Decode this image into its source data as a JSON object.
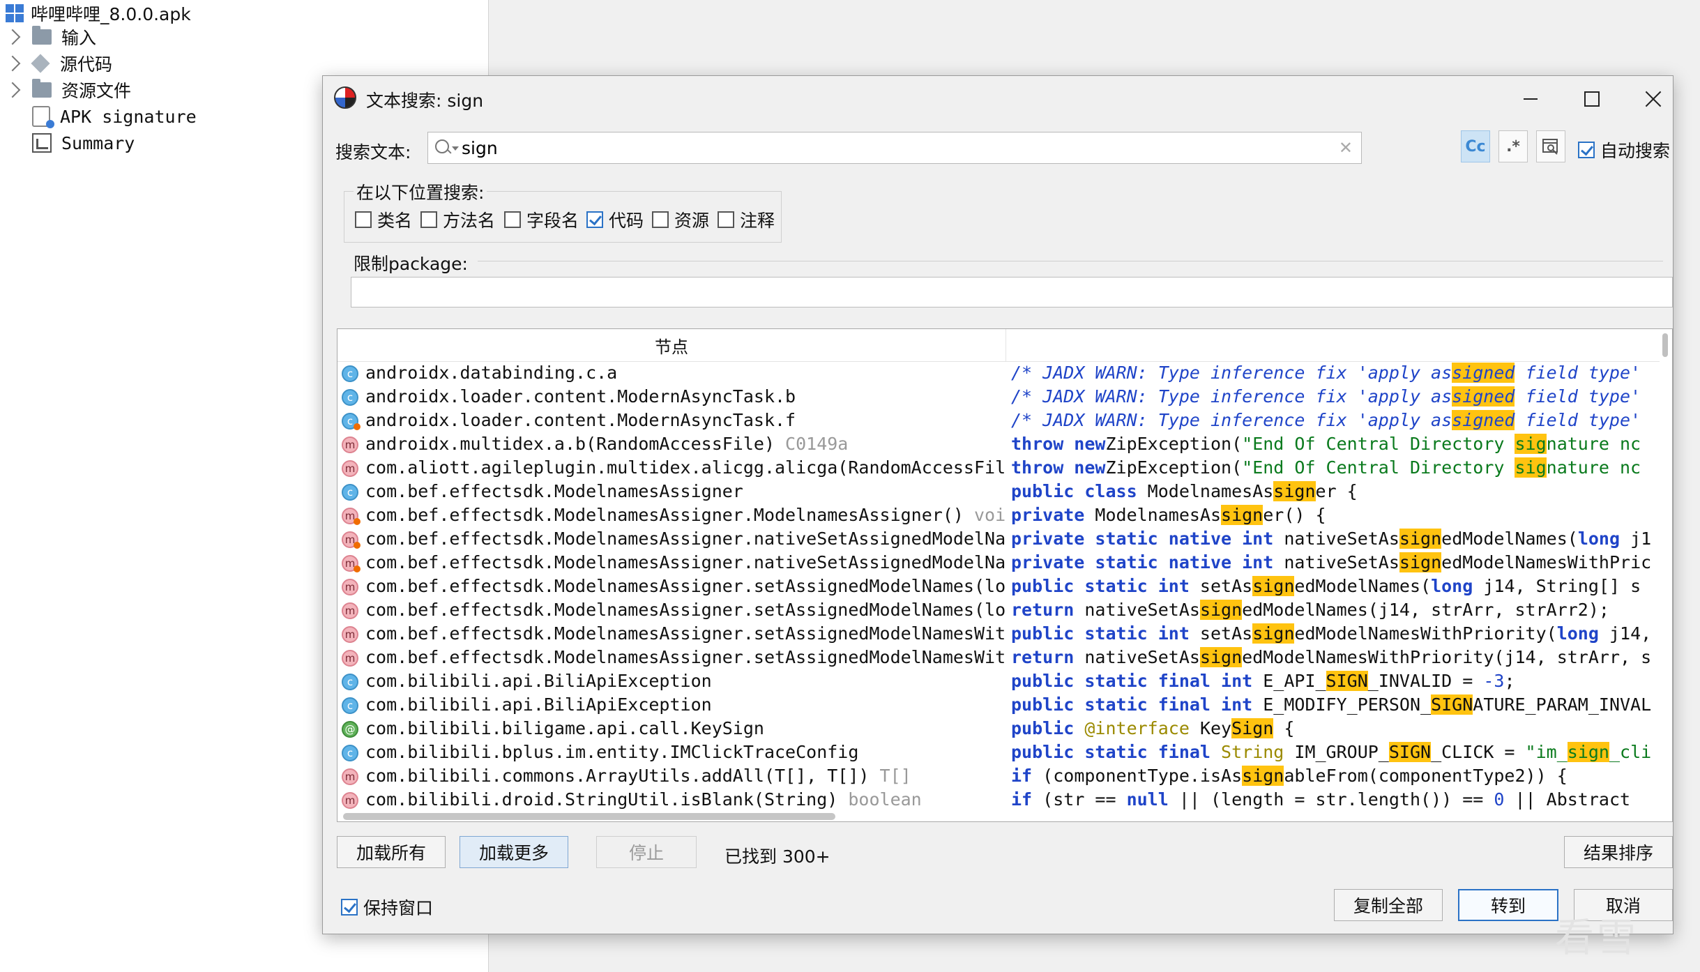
{
  "tree": {
    "root": "哔哩哔哩_8.0.0.apk",
    "items": [
      "输入",
      "源代码",
      "资源文件",
      "APK signature",
      "Summary"
    ]
  },
  "dialog": {
    "title": "文本搜索: sign",
    "search_label": "搜索文本:",
    "search_value": "sign",
    "case_label": "Cc",
    "regex_label": ".*",
    "auto_search_label": "自动搜索",
    "scope_title": "在以下位置搜索:",
    "scope_options": [
      {
        "label": "类名",
        "checked": false
      },
      {
        "label": "方法名",
        "checked": false
      },
      {
        "label": "字段名",
        "checked": false
      },
      {
        "label": "代码",
        "checked": true
      },
      {
        "label": "资源",
        "checked": false
      },
      {
        "label": "注释",
        "checked": false
      }
    ],
    "package_label": "限制package:",
    "package_value": "",
    "column_node": "节点",
    "rows": [
      {
        "icon": "class",
        "dot": "",
        "node": "androidx.databinding.c.a",
        "sub": "",
        "code": [
          [
            "cm",
            "/* JADX WARN: Type inference fix 'apply as"
          ],
          [
            "cm hl",
            "signed"
          ],
          [
            "cm",
            " field type' "
          ]
        ]
      },
      {
        "icon": "class",
        "dot": "",
        "node": "androidx.loader.content.ModernAsyncTask.b",
        "sub": "",
        "code": [
          [
            "cm",
            "/* JADX WARN: Type inference fix 'apply as"
          ],
          [
            "cm hl",
            "signed"
          ],
          [
            "cm",
            " field type' "
          ]
        ]
      },
      {
        "icon": "class",
        "dot": "orange",
        "node": "androidx.loader.content.ModernAsyncTask.f",
        "sub": "",
        "code": [
          [
            "cm",
            "/* JADX WARN: Type inference fix 'apply as"
          ],
          [
            "cm hl",
            "signed"
          ],
          [
            "cm",
            " field type' "
          ]
        ]
      },
      {
        "icon": "method",
        "dot": "",
        "node": "androidx.multidex.a.b(RandomAccessFile)",
        "sub": " C0149a",
        "code": [
          [
            "kw",
            "throw new"
          ],
          [
            "",
            "ZipException("
          ],
          [
            "st",
            "\"End Of Central Directory "
          ],
          [
            "st hl",
            "sig"
          ],
          [
            "st",
            "nature nc"
          ]
        ]
      },
      {
        "icon": "method",
        "dot": "",
        "node": "com.aliott.agileplugin.multidex.alicgg.alicga(RandomAccessFil",
        "sub": "",
        "code": [
          [
            "kw",
            "throw new"
          ],
          [
            "",
            "ZipException("
          ],
          [
            "st",
            "\"End Of Central Directory "
          ],
          [
            "st hl",
            "sig"
          ],
          [
            "st",
            "nature nc"
          ]
        ]
      },
      {
        "icon": "class",
        "dot": "",
        "node": "com.bef.effectsdk.ModelnamesAssigner",
        "sub": "",
        "code": [
          [
            "kw",
            "public class"
          ],
          [
            "",
            " ModelnamesAs"
          ],
          [
            "hl",
            "sign"
          ],
          [
            "",
            "er {"
          ]
        ]
      },
      {
        "icon": "method",
        "dot": "orange",
        "node": "com.bef.effectsdk.ModelnamesAssigner.ModelnamesAssigner()",
        "sub": " voi",
        "code": [
          [
            "kw",
            "private"
          ],
          [
            "",
            " ModelnamesAs"
          ],
          [
            "hl",
            "sign"
          ],
          [
            "",
            "er() {"
          ]
        ]
      },
      {
        "icon": "method",
        "dot": "orange",
        "node": "com.bef.effectsdk.ModelnamesAssigner.nativeSetAssignedModelNa",
        "sub": "",
        "code": [
          [
            "kw",
            "private static native int"
          ],
          [
            "",
            " nativeSetAs"
          ],
          [
            "hl",
            "sign"
          ],
          [
            "",
            "edModelNames("
          ],
          [
            "kw",
            "long"
          ],
          [
            "",
            " j1"
          ]
        ]
      },
      {
        "icon": "method",
        "dot": "orange",
        "node": "com.bef.effectsdk.ModelnamesAssigner.nativeSetAssignedModelNa",
        "sub": "",
        "code": [
          [
            "kw",
            "private static native int"
          ],
          [
            "",
            " nativeSetAs"
          ],
          [
            "hl",
            "sign"
          ],
          [
            "",
            "edModelNamesWithPric"
          ]
        ]
      },
      {
        "icon": "method",
        "dot": "",
        "node": "com.bef.effectsdk.ModelnamesAssigner.setAssignedModelNames(lo",
        "sub": "",
        "code": [
          [
            "kw",
            "public static int"
          ],
          [
            "",
            " setAs"
          ],
          [
            "hl",
            "sign"
          ],
          [
            "",
            "edModelNames("
          ],
          [
            "kw",
            "long"
          ],
          [
            "",
            " j14, String[] s"
          ]
        ]
      },
      {
        "icon": "method",
        "dot": "",
        "node": "com.bef.effectsdk.ModelnamesAssigner.setAssignedModelNames(lo",
        "sub": "",
        "code": [
          [
            "kw",
            "return"
          ],
          [
            "",
            " nativeSetAs"
          ],
          [
            "hl",
            "sign"
          ],
          [
            "",
            "edModelNames(j14, strArr, strArr2);"
          ]
        ]
      },
      {
        "icon": "method",
        "dot": "",
        "node": "com.bef.effectsdk.ModelnamesAssigner.setAssignedModelNamesWit",
        "sub": "",
        "code": [
          [
            "kw",
            "public static int"
          ],
          [
            "",
            " setAs"
          ],
          [
            "hl",
            "sign"
          ],
          [
            "",
            "edModelNamesWithPriority("
          ],
          [
            "kw",
            "long"
          ],
          [
            "",
            " j14,"
          ]
        ]
      },
      {
        "icon": "method",
        "dot": "",
        "node": "com.bef.effectsdk.ModelnamesAssigner.setAssignedModelNamesWit",
        "sub": "",
        "code": [
          [
            "kw",
            "return"
          ],
          [
            "",
            " nativeSetAs"
          ],
          [
            "hl",
            "sign"
          ],
          [
            "",
            "edModelNamesWithPriority(j14, strArr, s"
          ]
        ]
      },
      {
        "icon": "class",
        "dot": "",
        "node": "com.bilibili.api.BiliApiException",
        "sub": "",
        "code": [
          [
            "kw",
            "public static final int"
          ],
          [
            "",
            " E_API_"
          ],
          [
            "hl",
            "SIGN"
          ],
          [
            "",
            "_INVALID = "
          ],
          [
            "num",
            "-3"
          ],
          [
            "",
            ";"
          ]
        ]
      },
      {
        "icon": "class",
        "dot": "",
        "node": "com.bilibili.api.BiliApiException",
        "sub": "",
        "code": [
          [
            "kw",
            "public static final int"
          ],
          [
            "",
            " E_MODIFY_PERSON_"
          ],
          [
            "hl",
            "SIGN"
          ],
          [
            "",
            "ATURE_PARAM_INVAL"
          ]
        ]
      },
      {
        "icon": "annot",
        "dot": "",
        "node": "com.bilibili.biligame.api.call.KeySign",
        "sub": "",
        "code": [
          [
            "kw",
            "public"
          ],
          [
            "an",
            " @interface"
          ],
          [
            "",
            " Key"
          ],
          [
            "hl",
            "Sign"
          ],
          [
            "",
            " {"
          ]
        ]
      },
      {
        "icon": "class",
        "dot": "",
        "node": "com.bilibili.bplus.im.entity.IMClickTraceConfig",
        "sub": "",
        "code": [
          [
            "kw",
            "public static final"
          ],
          [
            "an",
            " String"
          ],
          [
            "",
            " IM_GROUP_"
          ],
          [
            "hl",
            "SIGN"
          ],
          [
            "",
            "_CLICK = "
          ],
          [
            "st",
            "\"im_"
          ],
          [
            "st hl",
            "sign"
          ],
          [
            "st",
            "_cli"
          ]
        ]
      },
      {
        "icon": "method",
        "dot": "",
        "node": "com.bilibili.commons.ArrayUtils.addAll(T[], T[])",
        "sub": " T[]",
        "code": [
          [
            "kw",
            "if"
          ],
          [
            "",
            " (componentType.isAs"
          ],
          [
            "hl",
            "sign"
          ],
          [
            "",
            "ableFrom(componentType2)) {"
          ]
        ]
      },
      {
        "icon": "method",
        "dot": "",
        "node": "com.bilibili.droid.StringUtil.isBlank(String)",
        "sub": " boolean",
        "code": [
          [
            "kw",
            "if"
          ],
          [
            "",
            " (str == "
          ],
          [
            "kw",
            "null"
          ],
          [
            "",
            " || (length = str.length()) == "
          ],
          [
            "num",
            "0"
          ],
          [
            "",
            " || Abstract"
          ]
        ]
      }
    ],
    "load_all_label": "加载所有",
    "load_more_label": "加载更多",
    "stop_label": "停止",
    "found_label": "已找到 300+",
    "sort_label": "结果排序",
    "keep_window_label": "保持窗口",
    "copy_all_label": "复制全部",
    "goto_label": "转到",
    "cancel_label": "取消"
  },
  "watermark": "看雪"
}
